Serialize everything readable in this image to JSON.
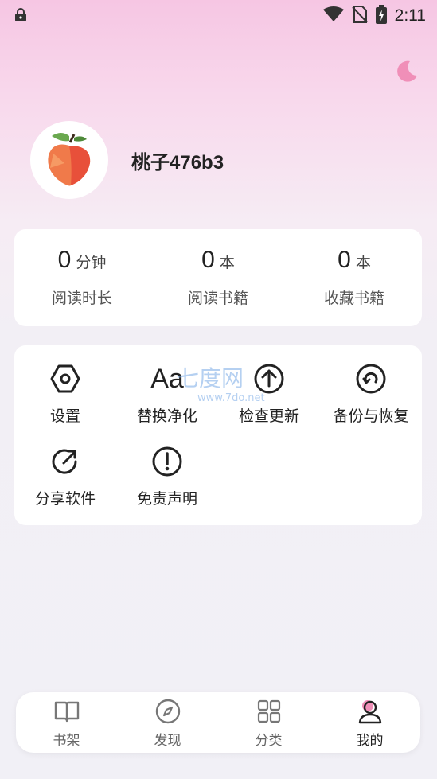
{
  "status_bar": {
    "time": "2:11"
  },
  "profile": {
    "username": "桃子476b3"
  },
  "stats": [
    {
      "value": "0",
      "unit": "分钟",
      "label": "阅读时长"
    },
    {
      "value": "0",
      "unit": "本",
      "label": "阅读书籍"
    },
    {
      "value": "0",
      "unit": "本",
      "label": "收藏书籍"
    }
  ],
  "menu": [
    {
      "label": "设置",
      "icon": "settings-hexagon-icon"
    },
    {
      "label": "替换净化",
      "icon": "font-aa-icon",
      "icon_text": "Aa"
    },
    {
      "label": "检查更新",
      "icon": "upload-arrow-icon"
    },
    {
      "label": "备份与恢复",
      "icon": "backup-restore-icon"
    },
    {
      "label": "分享软件",
      "icon": "share-icon"
    },
    {
      "label": "免责声明",
      "icon": "exclamation-icon"
    }
  ],
  "watermark": {
    "title": "七度网",
    "url": "www.7do.net"
  },
  "bottom_nav": [
    {
      "label": "书架",
      "icon": "book-icon",
      "active": false
    },
    {
      "label": "发现",
      "icon": "compass-icon",
      "active": false
    },
    {
      "label": "分类",
      "icon": "grid-icon",
      "active": false
    },
    {
      "label": "我的",
      "icon": "user-icon",
      "active": true
    }
  ],
  "colors": {
    "accent_pink": "#f08fb8",
    "background_top": "#f6c6e3",
    "background_bottom": "#f1f0f6"
  }
}
